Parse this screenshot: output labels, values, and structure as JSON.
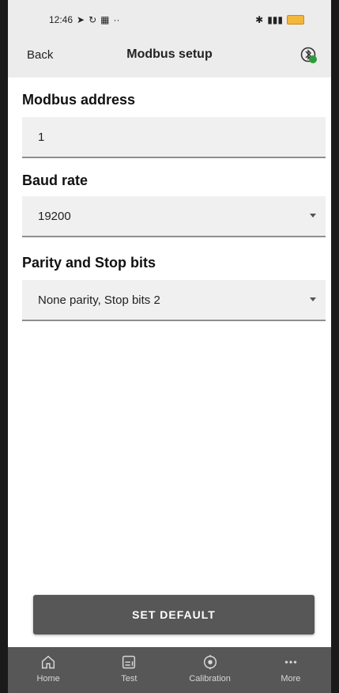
{
  "status_bar": {
    "time": "12:46",
    "left_icons": [
      "location-arrow-icon",
      "sync-icon",
      "qr-icon",
      "more-dots-icon"
    ],
    "right_icons": [
      "bluetooth-icon",
      "signal-icon",
      "battery-icon"
    ]
  },
  "header": {
    "back_label": "Back",
    "title": "Modbus setup",
    "action_icon": "bluetooth-connected-icon"
  },
  "form": {
    "address": {
      "label": "Modbus address",
      "value": "1"
    },
    "baud": {
      "label": "Baud rate",
      "value": "19200"
    },
    "parity": {
      "label": "Parity and Stop bits",
      "value": "None parity, Stop bits 2"
    }
  },
  "actions": {
    "set_default": "SET DEFAULT"
  },
  "bottom_nav": [
    {
      "label": "Home",
      "icon": "home-icon"
    },
    {
      "label": "Test",
      "icon": "test-icon"
    },
    {
      "label": "Calibration",
      "icon": "calibration-icon"
    },
    {
      "label": "More",
      "icon": "more-icon"
    }
  ],
  "colors": {
    "header_bg": "#ececec",
    "button_bg": "#575757",
    "nav_bg": "#575757",
    "accent_green": "#2e9b3a"
  }
}
